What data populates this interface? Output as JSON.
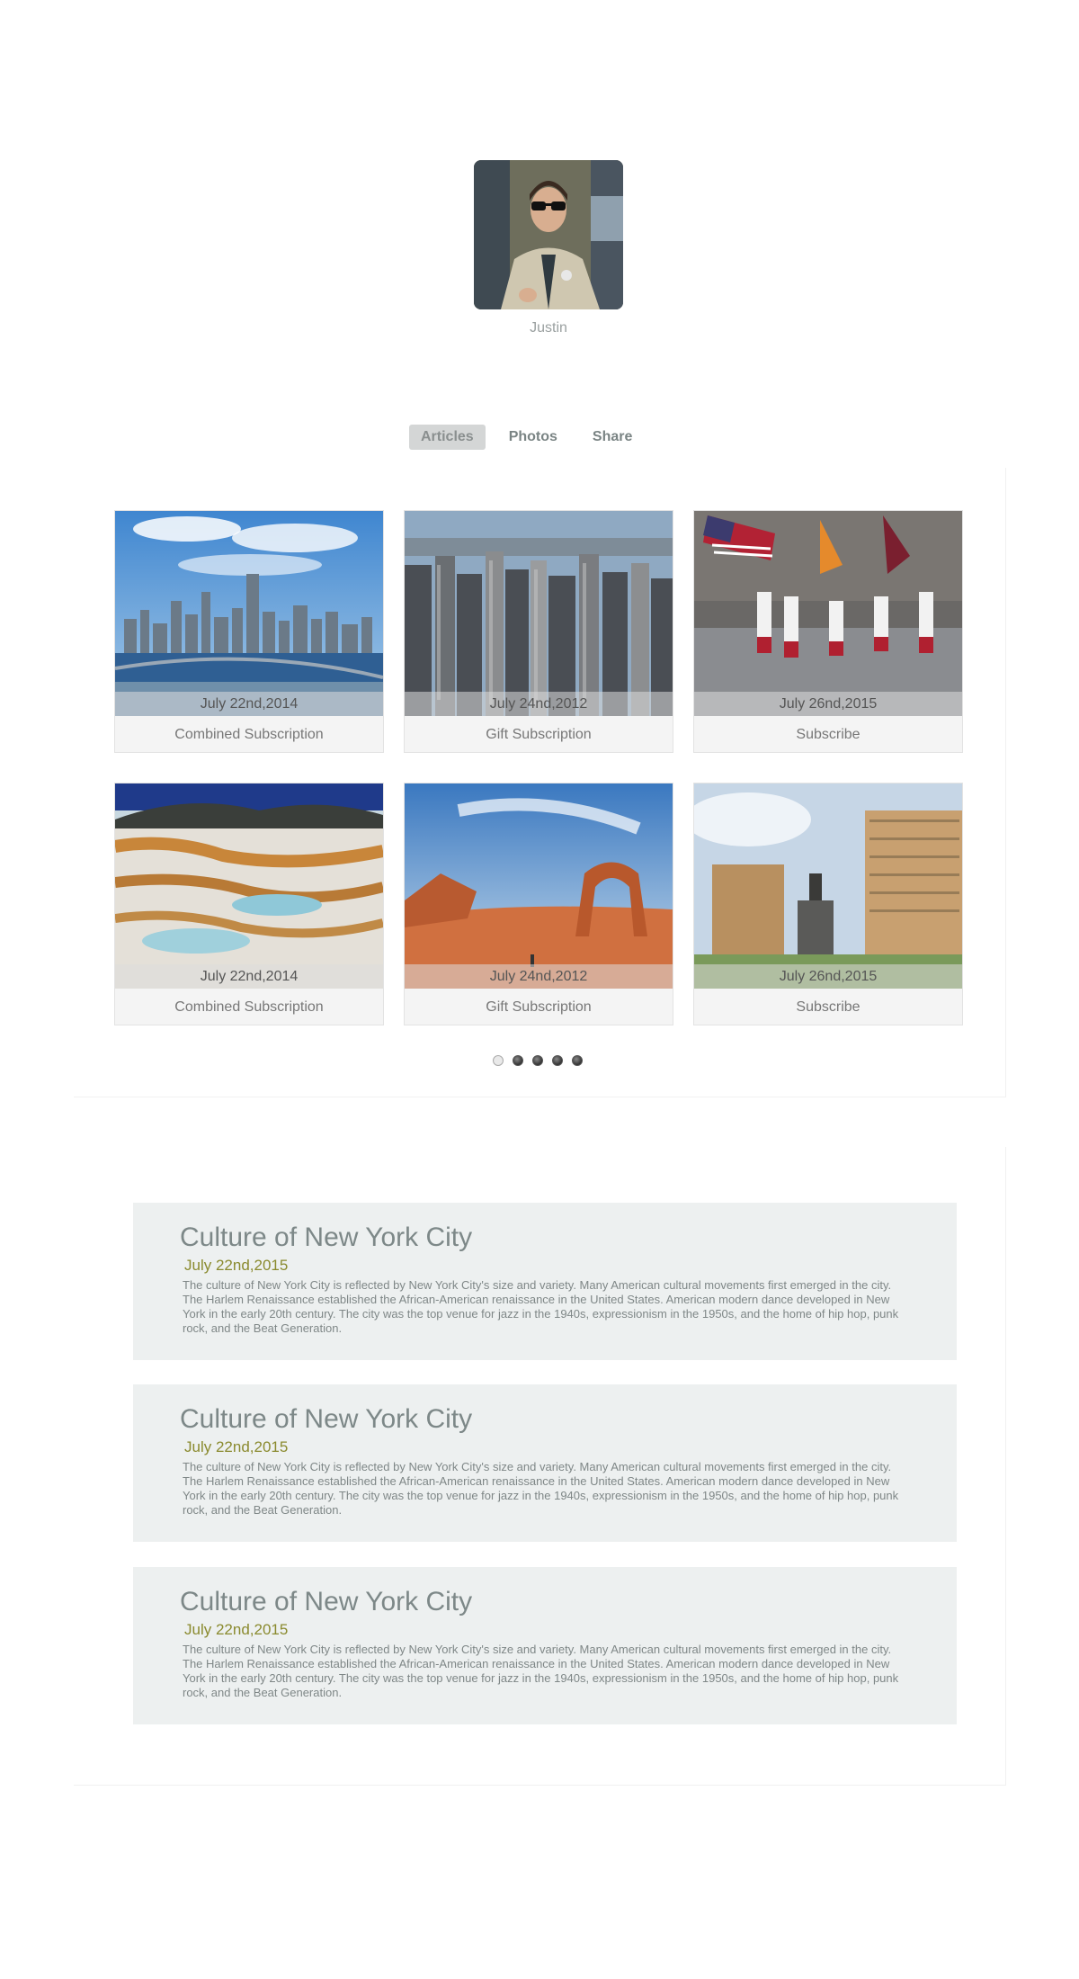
{
  "profile": {
    "name": "Justin"
  },
  "tabs": [
    {
      "label": "Articles",
      "active": true
    },
    {
      "label": "Photos",
      "active": false
    },
    {
      "label": "Share",
      "active": false
    }
  ],
  "gallery": {
    "cards": [
      {
        "date": "July 22nd,2014",
        "caption": "Combined Subscription",
        "image": "new-york-skyline-bridge"
      },
      {
        "date": "July 24nd,2012",
        "caption": "Gift Subscription",
        "image": "manhattan-aerial"
      },
      {
        "date": "July 26nd,2015",
        "caption": "Subscribe",
        "image": "parade-with-flags"
      },
      {
        "date": "July 22nd,2014",
        "caption": "Combined Subscription",
        "image": "travertine-terraces"
      },
      {
        "date": "July 24nd,2012",
        "caption": "Gift Subscription",
        "image": "desert-arch"
      },
      {
        "date": "July 26nd,2015",
        "caption": "Subscribe",
        "image": "city-square-statue"
      }
    ],
    "pagination_dots": 5,
    "active_dot": 0
  },
  "articles": [
    {
      "title": "Culture of New York City",
      "date": "July 22nd,2015",
      "body": "The culture of New York City is reflected by New York City's size and variety. Many American cultural movements first emerged in the city. The Harlem Renaissance established the African-American renaissance in the United States. American modern dance developed in New York in the early 20th century. The city was the top venue for jazz in the 1940s, expressionism in the 1950s, and the home of hip hop, punk rock, and the Beat Generation."
    },
    {
      "title": "Culture of New York City",
      "date": "July 22nd,2015",
      "body": "The culture of New York City is reflected by New York City's size and variety. Many American cultural movements first emerged in the city. The Harlem Renaissance established the African-American renaissance in the United States. American modern dance developed in New York in the early 20th century. The city was the top venue for jazz in the 1940s, expressionism in the 1950s, and the home of hip hop, punk rock, and the Beat Generation."
    },
    {
      "title": "Culture of New York City",
      "date": "July 22nd,2015",
      "body": "The culture of New York City is reflected by New York City's size and variety. Many American cultural movements first emerged in the city. The Harlem Renaissance established the African-American renaissance in the United States. American modern dance developed in New York in the early 20th century. The city was the top venue for jazz in the 1940s, expressionism in the 1950s, and the home of hip hop, punk rock, and the Beat Generation."
    }
  ],
  "colors": {
    "tab_active_bg": "#d4d6d6",
    "article_bg": "#edf0f0",
    "article_date": "#8a8a2e",
    "article_title": "#7d8888"
  }
}
